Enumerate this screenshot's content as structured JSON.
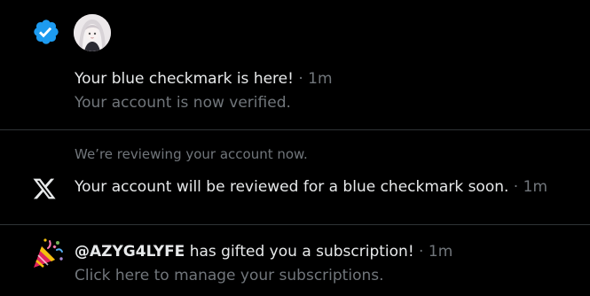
{
  "colors": {
    "background": "#000000",
    "text_primary": "#e7e9ea",
    "text_secondary": "#71767b",
    "divider": "#2f3336",
    "verified_blue": "#1d9bf0"
  },
  "notifications": [
    {
      "icon": "verified-badge-icon",
      "title": "Your blue checkmark is here!",
      "separator": " · ",
      "time": "1m",
      "subtitle": "Your account is now verified."
    },
    {
      "icon": "x-logo-icon",
      "context": "We’re reviewing your account now.",
      "title": "Your account will be reviewed for a blue checkmark soon.",
      "separator": " · ",
      "time": "1m"
    },
    {
      "icon": "party-popper-icon",
      "username": "@AZYG4LYFE",
      "title_rest": " has gifted you a subscription!",
      "separator": " · ",
      "time": "1m",
      "subtitle": "Click here to manage your subscriptions."
    }
  ]
}
